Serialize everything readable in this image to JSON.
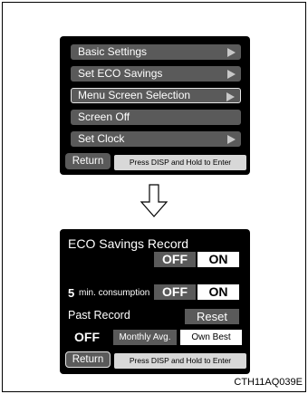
{
  "menu": {
    "items": [
      {
        "label": "Basic Settings",
        "has_arrow": true
      },
      {
        "label": "Set ECO Savings",
        "has_arrow": true
      },
      {
        "label": "Menu Screen Selection",
        "has_arrow": true,
        "selected": true
      },
      {
        "label": "Screen Off",
        "has_arrow": false
      },
      {
        "label": "Set Clock",
        "has_arrow": true
      }
    ],
    "return_label": "Return",
    "hint": "Press DISP and Hold to Enter"
  },
  "eco": {
    "title": "ECO Savings Record",
    "record_off": "OFF",
    "record_on": "ON",
    "consumption_value": "5",
    "consumption_unit": "min. consumption",
    "consumption_off": "OFF",
    "consumption_on": "ON",
    "past_record_label": "Past Record",
    "reset_label": "Reset",
    "past_off": "OFF",
    "monthly_avg": "Monthly Avg.",
    "own_best": "Own Best",
    "return_label": "Return",
    "hint": "Press DISP and Hold to Enter"
  },
  "caption": "CTH11AQ039E",
  "icons": {
    "menu_arrow": "right-arrow-icon",
    "transition": "down-arrow-icon"
  },
  "colors": {
    "screen": "#000000",
    "button": "#5a5a5a",
    "selected_option": "#ffffff",
    "hint_bar": "#d8d8d8"
  }
}
